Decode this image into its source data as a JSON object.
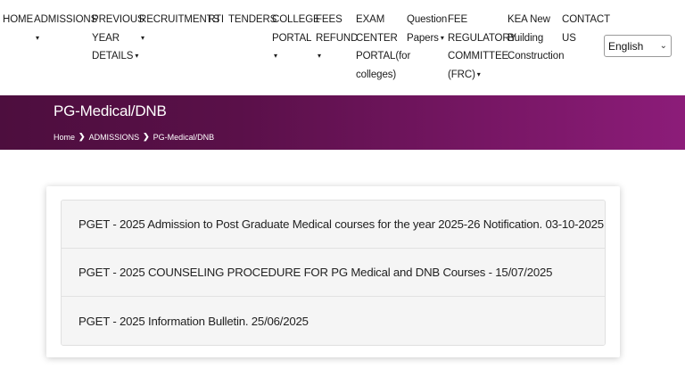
{
  "nav": {
    "home": "HOME",
    "admissions": "ADMISSIONS",
    "previous_year_details": [
      "PREVIOUS",
      "YEAR",
      "DETAILS"
    ],
    "recruitments": "RECRUITMENTS",
    "rti": "RTI",
    "tenders": "TENDERS",
    "college_portal": [
      "COLLEGE",
      "PORTAL"
    ],
    "fees_refund": [
      "FEES",
      "REFUND"
    ],
    "exam_center_portal": [
      "EXAM",
      "CENTER",
      "PORTAL(for",
      "colleges)"
    ],
    "question_papers": [
      "Question",
      "Papers"
    ],
    "fee_regulatory": [
      "FEE",
      "REGULATORY",
      "COMMITTEE",
      "(FRC)"
    ],
    "kea_new_building": [
      "KEA New",
      "Building",
      "Construction"
    ],
    "contact_us": [
      "CONTACT",
      "US"
    ],
    "caret": "▾"
  },
  "language": {
    "selected": "English",
    "chevron": "⌄"
  },
  "banner": {
    "title": "PG-Medical/DNB",
    "breadcrumb": [
      "Home",
      "ADMISSIONS",
      "PG-Medical/DNB"
    ],
    "separator": "❯"
  },
  "notifications": [
    "PGET - 2025 Admission to Post Graduate Medical courses for the year 2025-26 Notification. 03-10-2025",
    "PGET - 2025 COUNSELING PROCEDURE FOR PG Medical and DNB Courses - 15/07/2025",
    "PGET - 2025 Information Bulletin. 25/06/2025"
  ]
}
